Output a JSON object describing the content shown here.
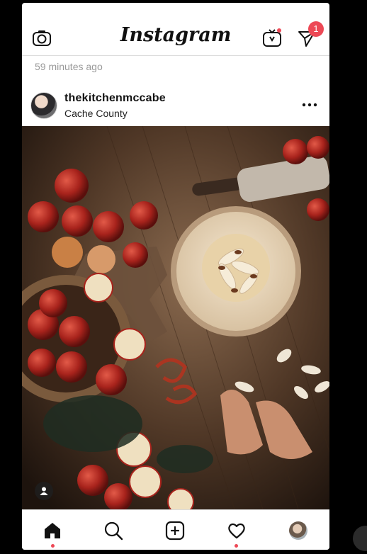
{
  "header": {
    "logo_text": "Instagram",
    "notification_count": "1"
  },
  "post": {
    "timestamp": "59 minutes ago",
    "username": "thekitchenmccabe",
    "location": "Cache County"
  },
  "nav": {
    "items": [
      "home-icon",
      "search-icon",
      "new-post-icon",
      "activity-heart-icon",
      "profile-avatar"
    ],
    "active": "home-icon"
  },
  "colors": {
    "accent_badge": "#ed4956",
    "divider": "#dbdbdb"
  }
}
